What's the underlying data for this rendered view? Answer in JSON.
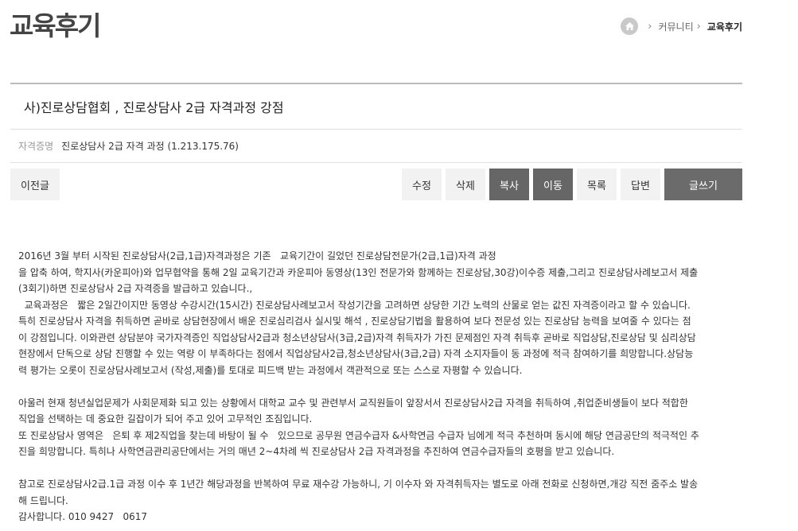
{
  "page": {
    "title": "교육후기"
  },
  "breadcrumb": {
    "items": [
      "커뮤니티",
      "교육후기"
    ]
  },
  "post": {
    "title": "사)진로상담협회 , 진로상담사 2급 자격과정 강점",
    "meta_label": "자격증명",
    "meta_value": "진로상담사 2급 자격 과정  (1.213.175.76)"
  },
  "buttons": {
    "prev": "이전글",
    "edit": "수정",
    "delete": "삭제",
    "copy": "복사",
    "move": "이동",
    "list": "목록",
    "reply": "답변",
    "write": "글쓰기"
  },
  "content": {
    "lines": [
      "2016년 3월 부터 시작된 진로상담사(2급,1급)자격과정은 기존   교육기간이 길었던 진로상담전문가(2급,1급)자격 과정",
      "을 압축 하여, 학지사(카운피아)와 업무협약을 통해 2일 교육기간과 카운피아 동영상(13인 전문가와 함께하는 진로상담,30강)이수증 제출,그리고 진로상담사례보고서 제출",
      "(3회기)하면 진로상담사 2급 자격증을 발급하고 있습니다.,",
      "  교육과정은   짧은 2일간이지만 동영상 수강시간(15시간) 진로상담사례보고서 작성기간을 고려하면 상당한 기간 노력의 산물로 얻는 값진 자격증이라고 할 수 있습니다.",
      "특히 진로상담사 자격을 취득하면 곧바로 상담현장에서 배운 진로심리검사 실시및 해석 , 진로상담기법을 활용하여 보다 전문성 있는 진로상담 능력을 보여줄 수 있다는 점",
      "이 강점입니다. 이와관련 상담분야 국가자격증인 직업상담사2급과 청소년상담사(3급,2급)자격 취득자가 가진 문제점인 자격 취득후 곧바로 직업상담,진로상담 및 심리상담",
      "현장에서 단독으로 상담 진행할 수 있는 역량 이 부족하다는 점에서 직업상담사2급,청소년상담사(3급,2급) 자격 소지자들이 동 과정에 적극 참여하기를 희망합니다.상담능",
      "력 평가는 오롯이 진로상담사례보고서 (작성,제출)를 토대로 피드백 받는 과정에서 객관적으로 또는 스스로 자평할 수 있습니다.",
      "",
      "아울러 현재 청년실업문제가 사회문제화 되고 있는 상황에서 대학교 교수 및 관련부서 교직원들이 앞장서서 진로상담사2급 자격을 취득하여 ,취업준비생들이 보다 적합한",
      "직업을 선택하는 데 중요한 길잡이가 되어 주고 있어 고무적인 조짐입니다.",
      "또 진로상담사 영역은   은퇴 후 제2직업을 찾는데 바탕이 될 수   있으므로 공무원 연금수급자 &사학연금 수급자 님에게 적극 추천하며 동시에 해당 연금공단의 적극적인 추",
      "진을 희망합니다. 특히나 사학연금관리공단에서는 거의 매년 2~4차례 씩 진로상담사 2급 자격과정을 추진하여 연금수급자들의 호평을 받고 있습니다.",
      "",
      "참고로 진로상담사2급.1급 과정 이수 후 1년간 해당과정을 반복하여 무료 재수강 가능하니, 기 이수자 와 자격취득자는 별도로 아래 전화로 신청하면,개강 직전 줌주소 발송",
      "해 드립니다.",
      "감사합니다. 010 9427   0617"
    ]
  },
  "colors": {
    "dark_button": "#666666",
    "light_button": "#f2f2f2",
    "border": "#bbbbbb"
  }
}
